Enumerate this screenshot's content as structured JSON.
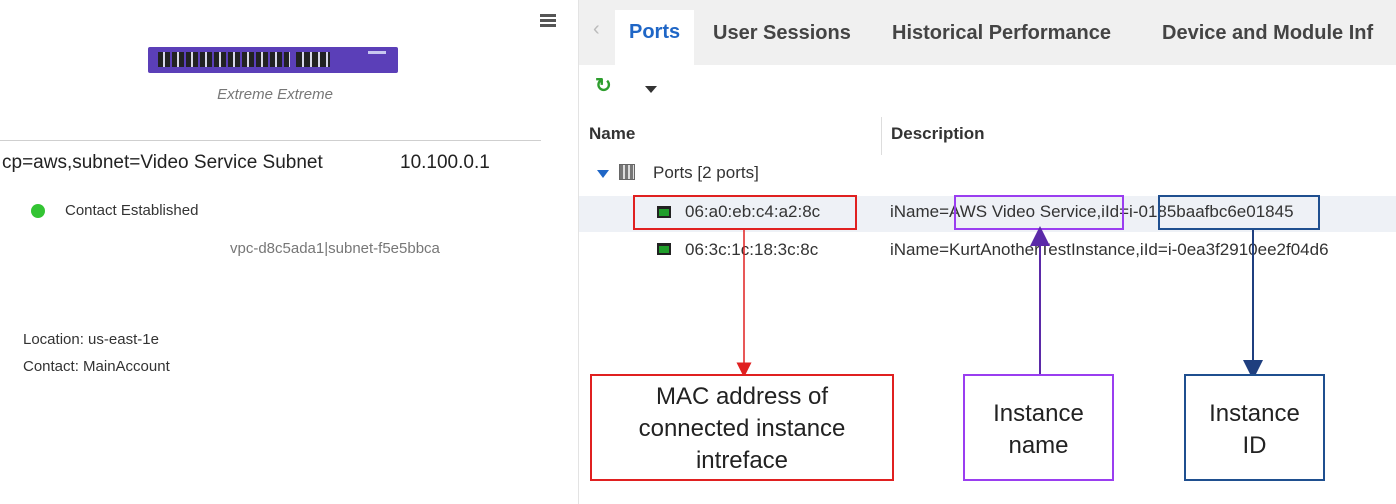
{
  "left_panel": {
    "device_name": "Extreme Extreme",
    "subnet": "cp=aws,subnet=Video Service Subnet",
    "ip": "10.100.0.1",
    "status": "Contact Established",
    "vpc": "vpc-d8c5ada1|subnet-f5e5bbca",
    "location": "Location: us-east-1e",
    "contact": "Contact:  MainAccount"
  },
  "tabs": [
    {
      "label": "Ports"
    },
    {
      "label": "User Sessions"
    },
    {
      "label": "Historical Performance"
    },
    {
      "label": "Device and Module Inf"
    }
  ],
  "toolbar": {
    "refresh_icon": "refresh-icon"
  },
  "table": {
    "columns": [
      "Name",
      "Description"
    ],
    "group_label": "Ports [2 ports]",
    "rows": [
      {
        "mac": "06:a0:eb:c4:a2:8c",
        "description": "iName=AWS Video Service,iId=i-0185baafbc6e01845"
      },
      {
        "mac": "06:3c:1c:18:3c:8c",
        "description": "iName=KurtAnotherTestInstance,iId=i-0ea3f2910ee2f04d6"
      }
    ]
  },
  "annotations": {
    "mac_line1": "MAC address of",
    "mac_line2": "connected instance",
    "mac_line3": "intreface",
    "name_line1": "Instance",
    "name_line2": "name",
    "id_line1": "Instance",
    "id_line2": "ID"
  },
  "colors": {
    "accent": "#1f66c6",
    "status_ok": "#33c433",
    "red": "#e02020",
    "purple": "#9a3ef0",
    "navy": "#1f4f8f"
  }
}
